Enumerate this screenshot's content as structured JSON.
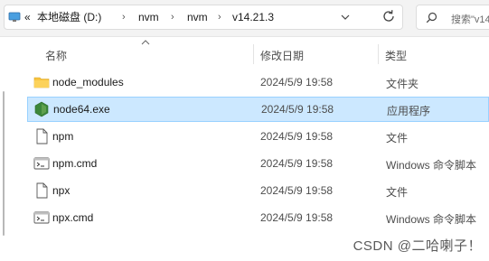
{
  "address_bar": {
    "overflow_glyph": "«",
    "crumbs": [
      "本地磁盘 (D:)",
      "nvm",
      "nvm",
      "v14.21.3"
    ],
    "separator": "›"
  },
  "search": {
    "placeholder": "搜索\"v14"
  },
  "columns": {
    "name": "名称",
    "modified": "修改日期",
    "type": "类型"
  },
  "files": [
    {
      "name": "node_modules",
      "modified": "2024/5/9 19:58",
      "type": "文件夹",
      "icon": "folder-icon",
      "selected": false
    },
    {
      "name": "node64.exe",
      "modified": "2024/5/9 19:58",
      "type": "应用程序",
      "icon": "node-app-icon",
      "selected": true
    },
    {
      "name": "npm",
      "modified": "2024/5/9 19:58",
      "type": "文件",
      "icon": "file-icon",
      "selected": false
    },
    {
      "name": "npm.cmd",
      "modified": "2024/5/9 19:58",
      "type": "Windows 命令脚本",
      "icon": "cmd-script-icon",
      "selected": false
    },
    {
      "name": "npx",
      "modified": "2024/5/9 19:58",
      "type": "文件",
      "icon": "file-icon",
      "selected": false
    },
    {
      "name": "npx.cmd",
      "modified": "2024/5/9 19:58",
      "type": "Windows 命令脚本",
      "icon": "cmd-script-icon",
      "selected": false
    }
  ],
  "watermark": "CSDN @二哈喇子！",
  "colors": {
    "selection_bg": "#cce8ff",
    "selection_border": "#99d1ff",
    "folder": "#f8c441",
    "node_green": "#3c873a"
  }
}
